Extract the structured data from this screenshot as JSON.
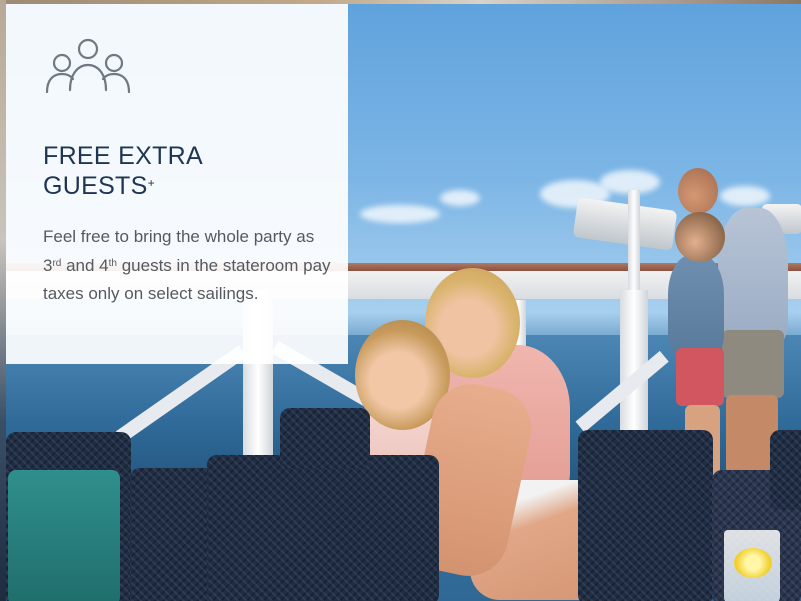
{
  "promo": {
    "icon": "group-of-people-icon",
    "title_line1": "FREE EXTRA",
    "title_line2": "GUESTS",
    "title_mark": "+",
    "body_part1": "Feel free to bring the whole party as 3",
    "body_sup1": "rd",
    "body_part2": " and 4",
    "body_sup2": "th",
    "body_part3": " guests in the stateroom pay taxes only on select sailings."
  },
  "photo": {
    "subject": "photo-background-icon"
  },
  "colors": {
    "title": "#1f3552",
    "body": "#555a60",
    "icon": "#707880",
    "card": "#ffffff"
  }
}
